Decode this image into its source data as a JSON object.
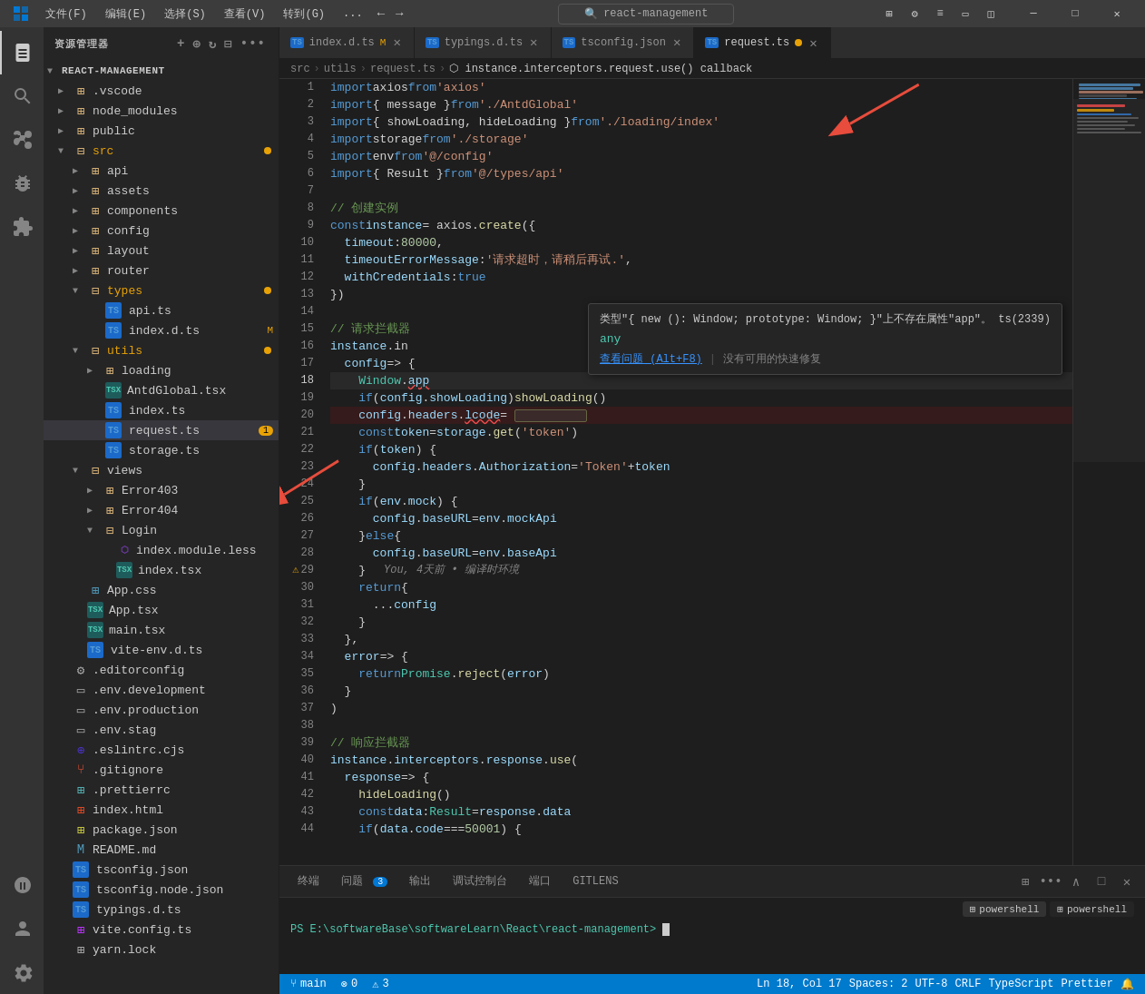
{
  "app": {
    "title": "react-management"
  },
  "menubar": {
    "items": [
      "文件(F)",
      "编辑(E)",
      "选择(S)",
      "查看(V)",
      "转到(G)",
      "..."
    ],
    "nav_back": "←",
    "nav_forward": "→",
    "search_placeholder": "react-management",
    "window_controls": [
      "□□",
      "□",
      "□□□□",
      "□",
      "□",
      "—",
      "□",
      "✕"
    ]
  },
  "activity_bar": {
    "icons": [
      {
        "name": "explorer-icon",
        "symbol": "⊞",
        "active": true
      },
      {
        "name": "search-icon",
        "symbol": "🔍",
        "active": false
      },
      {
        "name": "git-icon",
        "symbol": "⑂",
        "active": false
      },
      {
        "name": "debug-icon",
        "symbol": "▷",
        "active": false
      },
      {
        "name": "extensions-icon",
        "symbol": "⊞",
        "active": false
      },
      {
        "name": "remote-icon",
        "symbol": "⊡",
        "active": false
      },
      {
        "name": "account-icon",
        "symbol": "👤",
        "active": false
      },
      {
        "name": "settings-icon",
        "symbol": "⚙",
        "active": false
      }
    ]
  },
  "sidebar": {
    "title": "资源管理器",
    "project": "REACT-MANAGEMENT",
    "tree": [
      {
        "id": "vscode",
        "indent": 1,
        "label": ".vscode",
        "type": "folder",
        "expanded": false,
        "icon": "📁"
      },
      {
        "id": "node_modules",
        "indent": 1,
        "label": "node_modules",
        "type": "folder",
        "expanded": false,
        "icon": "📁"
      },
      {
        "id": "public",
        "indent": 1,
        "label": "public",
        "type": "folder",
        "expanded": false,
        "icon": "📁"
      },
      {
        "id": "src",
        "indent": 1,
        "label": "src",
        "type": "folder",
        "expanded": true,
        "icon": "📁",
        "modified": true
      },
      {
        "id": "api",
        "indent": 2,
        "label": "api",
        "type": "folder",
        "expanded": false,
        "icon": "📁"
      },
      {
        "id": "assets",
        "indent": 2,
        "label": "assets",
        "type": "folder",
        "expanded": false,
        "icon": "📁"
      },
      {
        "id": "components",
        "indent": 2,
        "label": "components",
        "type": "folder",
        "expanded": false,
        "icon": "📁"
      },
      {
        "id": "config",
        "indent": 2,
        "label": "config",
        "type": "folder",
        "expanded": false,
        "icon": "📁"
      },
      {
        "id": "layout",
        "indent": 2,
        "label": "layout",
        "type": "folder",
        "expanded": false,
        "icon": "📁"
      },
      {
        "id": "router",
        "indent": 2,
        "label": "router",
        "type": "folder",
        "expanded": false,
        "icon": "📁"
      },
      {
        "id": "types",
        "indent": 2,
        "label": "types",
        "type": "folder",
        "expanded": true,
        "icon": "📁",
        "modified": true
      },
      {
        "id": "api.ts",
        "indent": 3,
        "label": "api.ts",
        "type": "ts",
        "icon": "TS"
      },
      {
        "id": "index.d.ts",
        "indent": 3,
        "label": "index.d.ts",
        "type": "ts",
        "modified": "M"
      },
      {
        "id": "utils",
        "indent": 2,
        "label": "utils",
        "type": "folder",
        "expanded": true,
        "icon": "📁",
        "modified": true
      },
      {
        "id": "loading",
        "indent": 3,
        "label": "loading",
        "type": "folder",
        "expanded": false,
        "icon": "📁"
      },
      {
        "id": "AntdGlobal.tsx",
        "indent": 3,
        "label": "AntdGlobal.tsx",
        "type": "tsx"
      },
      {
        "id": "index.ts",
        "indent": 3,
        "label": "index.ts",
        "type": "ts"
      },
      {
        "id": "request.ts",
        "indent": 3,
        "label": "request.ts",
        "type": "ts",
        "badge": "1",
        "active": true
      },
      {
        "id": "storage.ts",
        "indent": 3,
        "label": "storage.ts",
        "type": "ts"
      },
      {
        "id": "views",
        "indent": 2,
        "label": "views",
        "type": "folder",
        "expanded": true,
        "icon": "📁"
      },
      {
        "id": "Error403",
        "indent": 3,
        "label": "Error403",
        "type": "folder",
        "expanded": false,
        "icon": "📁"
      },
      {
        "id": "Error404",
        "indent": 3,
        "label": "Error404",
        "type": "folder",
        "expanded": false,
        "icon": "📁"
      },
      {
        "id": "Login",
        "indent": 3,
        "label": "Login",
        "type": "folder",
        "expanded": true,
        "icon": "📁"
      },
      {
        "id": "index.module.less",
        "indent": 4,
        "label": "index.module.less",
        "type": "less"
      },
      {
        "id": "index.tsx",
        "indent": 4,
        "label": "index.tsx",
        "type": "tsx"
      },
      {
        "id": "App.css",
        "indent": 2,
        "label": "App.css",
        "type": "css"
      },
      {
        "id": "App.tsx",
        "indent": 2,
        "label": "App.tsx",
        "type": "tsx"
      },
      {
        "id": "main.tsx",
        "indent": 2,
        "label": "main.tsx",
        "type": "tsx"
      },
      {
        "id": "vite-env.d.ts",
        "indent": 2,
        "label": "vite-env.d.ts",
        "type": "ts"
      },
      {
        "id": "editorconfig",
        "indent": 1,
        "label": ".editorconfig",
        "type": "config"
      },
      {
        "id": "env.dev",
        "indent": 1,
        "label": ".env.development",
        "type": "env"
      },
      {
        "id": "env.prod",
        "indent": 1,
        "label": ".env.production",
        "type": "env"
      },
      {
        "id": "env.stag",
        "indent": 1,
        "label": ".env.stag",
        "type": "env"
      },
      {
        "id": "eslintrc",
        "indent": 1,
        "label": ".eslintrc.cjs",
        "type": "eslint"
      },
      {
        "id": "gitignore",
        "indent": 1,
        "label": ".gitignore",
        "type": "git"
      },
      {
        "id": "prettierrc",
        "indent": 1,
        "label": ".prettierrc",
        "type": "prettier"
      },
      {
        "id": "index.html",
        "indent": 1,
        "label": "index.html",
        "type": "html"
      },
      {
        "id": "package.json",
        "indent": 1,
        "label": "package.json",
        "type": "json"
      },
      {
        "id": "README.md",
        "indent": 1,
        "label": "README.md",
        "type": "md"
      },
      {
        "id": "tsconfig.json",
        "indent": 1,
        "label": "tsconfig.json",
        "type": "json"
      },
      {
        "id": "tsconfig.node.json",
        "indent": 1,
        "label": "tsconfig.node.json",
        "type": "json"
      },
      {
        "id": "typings.d.ts",
        "indent": 1,
        "label": "typings.d.ts",
        "type": "ts"
      },
      {
        "id": "vite.config.ts",
        "indent": 1,
        "label": "vite.config.ts",
        "type": "vite"
      },
      {
        "id": "yarn.lock",
        "indent": 1,
        "label": "yarn.lock",
        "type": "lock"
      }
    ]
  },
  "tabs": [
    {
      "id": "index-d-ts",
      "label": "index.d.ts",
      "lang": "TS",
      "modified": "M",
      "active": false
    },
    {
      "id": "typings-d-ts",
      "label": "typings.d.ts",
      "lang": "TS",
      "active": false
    },
    {
      "id": "tsconfig-json",
      "label": "tsconfig.json",
      "lang": "TS",
      "active": false
    },
    {
      "id": "request-ts",
      "label": "request.ts",
      "lang": "TS",
      "active": true,
      "dirty": true
    }
  ],
  "breadcrumb": {
    "items": [
      "src",
      ">",
      "utils",
      ">",
      "request.ts",
      ">",
      "⬡ instance.interceptors.request.use() callback"
    ]
  },
  "code": {
    "lines": [
      {
        "num": 1,
        "text": "import axios from 'axios'"
      },
      {
        "num": 2,
        "text": "import { message } from './AntdGlobal'"
      },
      {
        "num": 3,
        "text": "import { showLoading, hideLoading } from './loading/index'"
      },
      {
        "num": 4,
        "text": "import storage from './storage'"
      },
      {
        "num": 5,
        "text": "import env from '@/config'"
      },
      {
        "num": 6,
        "text": "import { Result } from '@/types/api'"
      },
      {
        "num": 7,
        "text": ""
      },
      {
        "num": 8,
        "text": "// 创建实例"
      },
      {
        "num": 9,
        "text": "const instance = axios.create({"
      },
      {
        "num": 10,
        "text": "  timeout: 80000,"
      },
      {
        "num": 11,
        "text": "  timeoutErrorMessage: '请求超时，请稍后再试.',"
      },
      {
        "num": 12,
        "text": "  withCredentials: true"
      },
      {
        "num": 13,
        "text": "})"
      },
      {
        "num": 14,
        "text": ""
      },
      {
        "num": 15,
        "text": "// 请求拦截器"
      },
      {
        "num": 16,
        "text": "instance.in"
      },
      {
        "num": 17,
        "text": "  config => {"
      },
      {
        "num": 18,
        "text": "    Window.app"
      },
      {
        "num": 19,
        "text": "    if (config.showLoading) showLoading()"
      },
      {
        "num": 20,
        "text": "    config.headers.lcode ="
      },
      {
        "num": 21,
        "text": "    const token = storage.get('token')"
      },
      {
        "num": 22,
        "text": "    if (token) {"
      },
      {
        "num": 23,
        "text": "      config.headers.Authorization = 'Token' + token"
      },
      {
        "num": 24,
        "text": "    }"
      },
      {
        "num": 25,
        "text": "    if (env.mock) {"
      },
      {
        "num": 26,
        "text": "      config.baseURL = env.mockApi"
      },
      {
        "num": 27,
        "text": "    } else {"
      },
      {
        "num": 28,
        "text": "      config.baseURL = env.baseApi"
      },
      {
        "num": 29,
        "text": "    }"
      },
      {
        "num": 30,
        "text": "    return {"
      },
      {
        "num": 31,
        "text": "      ...config"
      },
      {
        "num": 32,
        "text": "    }"
      },
      {
        "num": 33,
        "text": "  },"
      },
      {
        "num": 34,
        "text": "  error => {"
      },
      {
        "num": 35,
        "text": "    return Promise.reject(error)"
      },
      {
        "num": 36,
        "text": "  }"
      },
      {
        "num": 37,
        "text": ")"
      },
      {
        "num": 38,
        "text": ""
      },
      {
        "num": 39,
        "text": "// 响应拦截器"
      },
      {
        "num": 40,
        "text": "instance.interceptors.response.use("
      },
      {
        "num": 41,
        "text": "  response => {"
      },
      {
        "num": 42,
        "text": "    hideLoading()"
      },
      {
        "num": 43,
        "text": "    const data: Result = response.data"
      },
      {
        "num": 44,
        "text": "    if (data.code === 50001) {"
      }
    ]
  },
  "tooltip": {
    "type_text": "类型\"{ new (): Window; prototype: Window; }\"上不存在属性\"app\"。 ts(2339)",
    "any_label": "any",
    "action1": "查看问题 (Alt+F8)",
    "action2": "没有可用的快速修复"
  },
  "bottom_panel": {
    "tabs": [
      {
        "label": "终端",
        "active": false
      },
      {
        "label": "问题",
        "badge": "3",
        "active": false
      },
      {
        "label": "输出",
        "active": false
      },
      {
        "label": "调试控制台",
        "active": false
      },
      {
        "label": "端口",
        "active": false
      },
      {
        "label": "GITLENS",
        "active": false
      }
    ],
    "terminal_label": "powershell",
    "terminal_path": "PS E:\\softwareBase\\softwareLearn\\React\\react-management>",
    "terminal_lines": [
      "PS E:\\softwareBase\\softwareLearn\\React\\react-management>"
    ]
  },
  "status_bar": {
    "branch": "⑂ main",
    "errors": "⊗ 0",
    "warnings": "⚠ 3",
    "right_items": [
      "Ln 18, Col 17",
      "Spaces: 2",
      "UTF-8",
      "CRLF",
      "TypeScript",
      "Prettier",
      "⊞"
    ]
  },
  "colors": {
    "active_tab_border": "#0078d4",
    "modified": "#e8a206",
    "status_bar": "#007acc",
    "error": "#f14c4c",
    "warning": "#e8a206"
  }
}
